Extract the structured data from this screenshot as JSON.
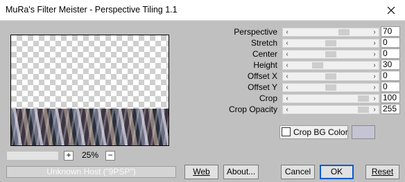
{
  "window": {
    "title": "MuRa's Filter Meister - Perspective Tiling 1.1"
  },
  "preview": {
    "zoom_minus": "−",
    "zoom_plus": "+",
    "zoom_value": "25%",
    "host_status": "Unknown Host (\"9PSP\")"
  },
  "params": [
    {
      "label": "Perspective",
      "value": "70",
      "fraction": 0.7
    },
    {
      "label": "Stretch",
      "value": "0",
      "fraction": 0.5
    },
    {
      "label": "Center",
      "value": "0",
      "fraction": 0.5
    },
    {
      "label": "Height",
      "value": "30",
      "fraction": 0.3
    },
    {
      "label": "Offset X",
      "value": "0",
      "fraction": 0.5
    },
    {
      "label": "Offset Y",
      "value": "0",
      "fraction": 0.5
    },
    {
      "label": "Crop",
      "value": "100",
      "fraction": 1.0
    },
    {
      "label": "Crop Opacity",
      "value": "255",
      "fraction": 1.0
    }
  ],
  "crop_bg": {
    "label": "Crop BG Color",
    "checked": false,
    "color": "#c4c4d4"
  },
  "buttons": {
    "web": "Web",
    "about": "About...",
    "cancel": "Cancel",
    "ok": "OK",
    "reset": "Reset"
  }
}
